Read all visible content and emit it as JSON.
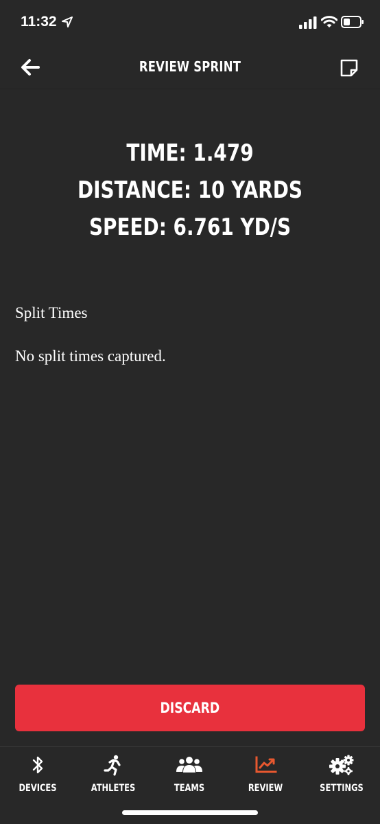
{
  "status": {
    "time": "11:32"
  },
  "nav": {
    "title": "REVIEW SPRINT"
  },
  "stats": {
    "time": "TIME: 1.479",
    "distance": "DISTANCE: 10 YARDS",
    "speed": "SPEED: 6.761 YD/S"
  },
  "splits": {
    "heading": "Split Times",
    "empty_message": "No split times captured."
  },
  "actions": {
    "discard_label": "DISCARD"
  },
  "tabs": [
    {
      "label": "DEVICES",
      "icon": "bluetooth-icon"
    },
    {
      "label": "ATHLETES",
      "icon": "runner-icon"
    },
    {
      "label": "TEAMS",
      "icon": "team-icon"
    },
    {
      "label": "REVIEW",
      "icon": "chart-icon",
      "active": true
    },
    {
      "label": "SETTINGS",
      "icon": "gears-icon"
    }
  ],
  "colors": {
    "background": "#282828",
    "accent": "#e8313d",
    "active_tab": "#e8582f"
  }
}
